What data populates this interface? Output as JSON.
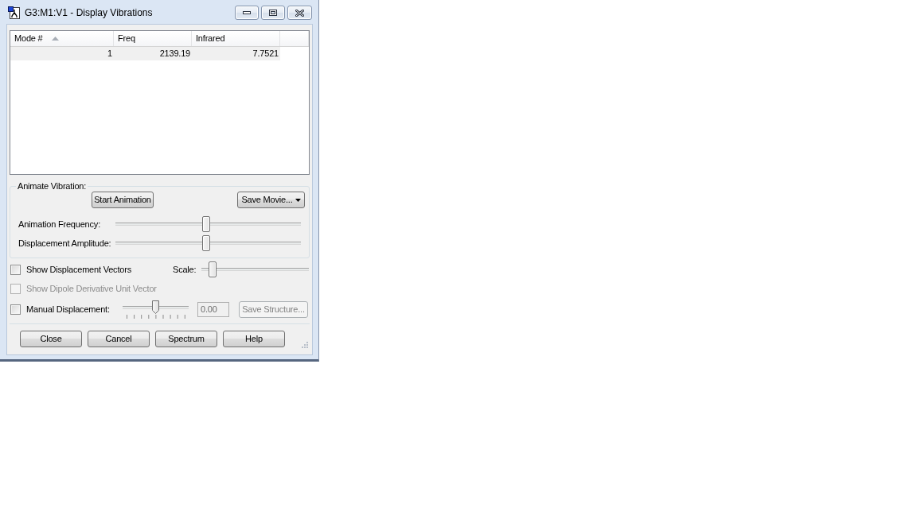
{
  "window": {
    "title": "G3:M1:V1 - Display Vibrations"
  },
  "table": {
    "columns": [
      {
        "label": "Mode #",
        "sorted": true
      },
      {
        "label": "Freq",
        "sorted": false
      },
      {
        "label": "Infrared",
        "sorted": false
      }
    ],
    "rows": [
      {
        "cells": [
          "1",
          "2139.19",
          "7.7521"
        ],
        "selected": true
      }
    ]
  },
  "animate_vibration": {
    "title": "Animate Vibration:",
    "start_button": "Start Animation",
    "save_movie_button": "Save Movie...",
    "sliders": [
      {
        "label": "Animation Frequency:",
        "level": 0.49
      },
      {
        "label": "Displacement Amplitude:",
        "level": 0.49
      }
    ]
  },
  "show_displacement_vectors": {
    "label": "Show Displacement Vectors",
    "checked": false,
    "disabled": false
  },
  "scale": {
    "label": "Scale:",
    "level": 0.07
  },
  "show_dipole_vector": {
    "label": "Show Dipole Derivative Unit Vector",
    "checked": false,
    "disabled": true
  },
  "manual_displacement": {
    "label": "Manual Displacement:",
    "checked": false,
    "disabled": false,
    "level": 0.5,
    "field": {
      "value": "0.00",
      "disabled": true
    }
  },
  "save_structure_button": {
    "label": "Save Structure...",
    "disabled": true
  },
  "buttons": [
    "Close",
    "Cancel",
    "Spectrum",
    "Help"
  ]
}
